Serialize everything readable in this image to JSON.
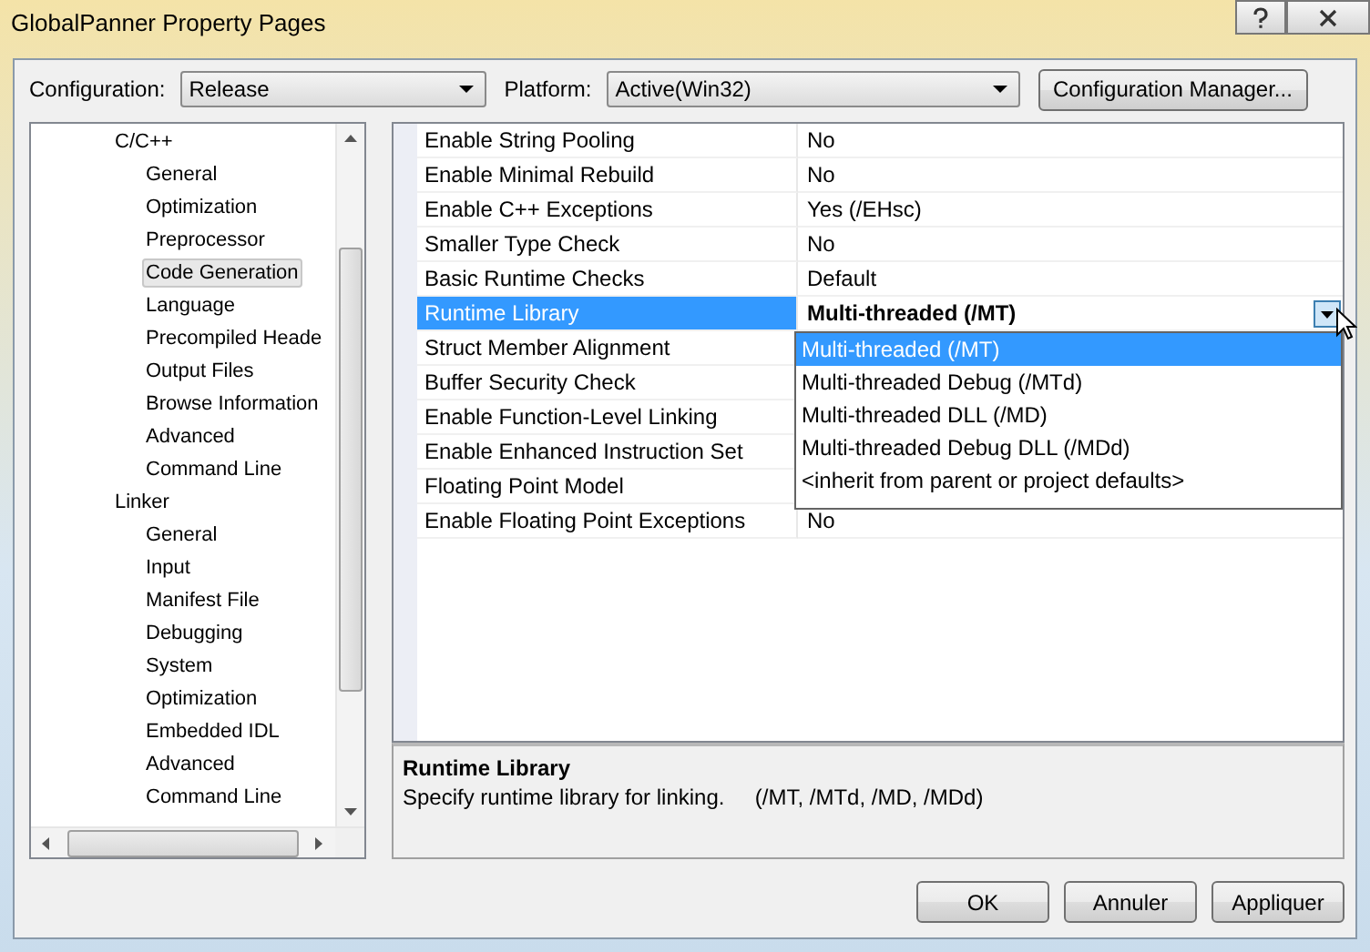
{
  "window": {
    "title": "GlobalPanner Property Pages"
  },
  "configuration": {
    "label": "Configuration:",
    "value": "Release"
  },
  "platform": {
    "label": "Platform:",
    "value": "Active(Win32)"
  },
  "config_manager_button": "Configuration Manager...",
  "tree": {
    "items": [
      {
        "label": "C/C++",
        "selected": false,
        "children": [
          {
            "label": "General",
            "selected": false
          },
          {
            "label": "Optimization",
            "selected": false
          },
          {
            "label": "Preprocessor",
            "selected": false
          },
          {
            "label": "Code Generation",
            "selected": true
          },
          {
            "label": "Language",
            "selected": false
          },
          {
            "label": "Precompiled Heade",
            "selected": false
          },
          {
            "label": "Output Files",
            "selected": false
          },
          {
            "label": "Browse Information",
            "selected": false
          },
          {
            "label": "Advanced",
            "selected": false
          },
          {
            "label": "Command Line",
            "selected": false
          }
        ]
      },
      {
        "label": "Linker",
        "selected": false,
        "children": [
          {
            "label": "General",
            "selected": false
          },
          {
            "label": "Input",
            "selected": false
          },
          {
            "label": "Manifest File",
            "selected": false
          },
          {
            "label": "Debugging",
            "selected": false
          },
          {
            "label": "System",
            "selected": false
          },
          {
            "label": "Optimization",
            "selected": false
          },
          {
            "label": "Embedded IDL",
            "selected": false
          },
          {
            "label": "Advanced",
            "selected": false
          },
          {
            "label": "Command Line",
            "selected": false
          }
        ]
      }
    ]
  },
  "properties": [
    {
      "name": "Enable String Pooling",
      "value": "No",
      "selected": false
    },
    {
      "name": "Enable Minimal Rebuild",
      "value": "No",
      "selected": false
    },
    {
      "name": "Enable C++ Exceptions",
      "value": "Yes (/EHsc)",
      "selected": false
    },
    {
      "name": "Smaller Type Check",
      "value": "No",
      "selected": false
    },
    {
      "name": "Basic Runtime Checks",
      "value": "Default",
      "selected": false
    },
    {
      "name": "Runtime Library",
      "value": "Multi-threaded (/MT)",
      "selected": true
    },
    {
      "name": "Struct Member Alignment",
      "selected": false
    },
    {
      "name": "Buffer Security Check",
      "selected": false
    },
    {
      "name": "Enable Function-Level Linking",
      "selected": false
    },
    {
      "name": "Enable Enhanced Instruction Set",
      "selected": false
    },
    {
      "name": "Floating Point Model",
      "selected": false
    },
    {
      "name": "Enable Floating Point Exceptions",
      "value": "No",
      "selected": false
    }
  ],
  "dropdown": {
    "options": [
      {
        "label": "Multi-threaded (/MT)",
        "selected": true
      },
      {
        "label": "Multi-threaded Debug (/MTd)",
        "selected": false
      },
      {
        "label": "Multi-threaded DLL (/MD)",
        "selected": false
      },
      {
        "label": "Multi-threaded Debug DLL (/MDd)",
        "selected": false
      },
      {
        "label": "<inherit from parent or project defaults>",
        "selected": false
      }
    ]
  },
  "description": {
    "title": "Runtime Library",
    "text": "Specify runtime library for linking.     (/MT, /MTd, /MD, /MDd)"
  },
  "buttons": [
    "OK",
    "Annuler",
    "Appliquer"
  ]
}
